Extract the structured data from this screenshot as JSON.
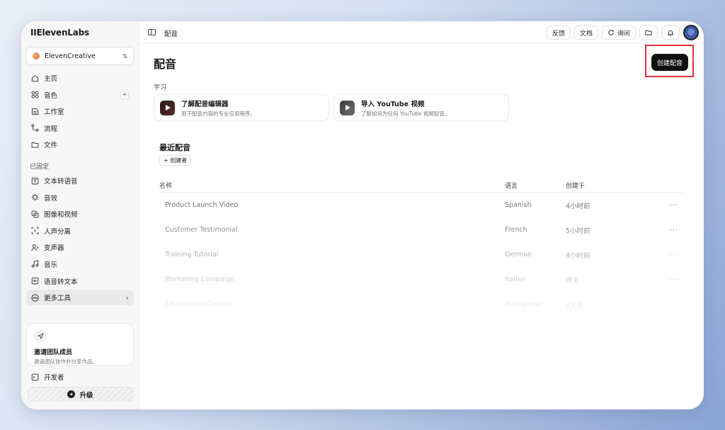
{
  "app": {
    "logo": "IIElevenLabs"
  },
  "workspace": {
    "name": "ElevenCreative"
  },
  "nav_main": [
    {
      "label": "主页",
      "icon": "home-icon"
    },
    {
      "label": "音色",
      "icon": "voices-icon",
      "plus": "+"
    },
    {
      "label": "工作室",
      "icon": "studio-icon"
    },
    {
      "label": "流程",
      "icon": "flow-icon"
    },
    {
      "label": "文件",
      "icon": "folder-icon"
    }
  ],
  "pinned_label": "已固定",
  "nav_pinned": [
    {
      "label": "文本转语音",
      "icon": "tts-icon"
    },
    {
      "label": "音效",
      "icon": "sound-effects-icon"
    },
    {
      "label": "图像和视频",
      "icon": "image-video-icon"
    },
    {
      "label": "人声分离",
      "icon": "voice-isolation-icon"
    },
    {
      "label": "变声器",
      "icon": "voice-changer-icon"
    },
    {
      "label": "音乐",
      "icon": "music-icon"
    },
    {
      "label": "语音转文本",
      "icon": "stt-icon"
    },
    {
      "label": "更多工具",
      "icon": "more-icon",
      "chevron": "›"
    }
  ],
  "invite": {
    "title": "邀请团队成员",
    "subtitle": "邀请团队协作并分享作品。"
  },
  "developer": {
    "label": "开发者"
  },
  "upgrade": {
    "label": "升级"
  },
  "topbar": {
    "breadcrumb": "配音",
    "feedback": "反馈",
    "docs": "文档",
    "ask": "询问"
  },
  "page": {
    "title": "配音",
    "create_button": "创建配音",
    "learn_label": "学习"
  },
  "learn_cards": [
    {
      "title": "了解配音编辑器",
      "subtitle": "用于配音内容的专业应用程序。"
    },
    {
      "title": "导入 YouTube 视频",
      "subtitle": "了解如何为任何 YouTube 视频配音。"
    }
  ],
  "recent": {
    "title": "最近配音",
    "creator_chip": "+ 创建者",
    "columns": {
      "name": "名称",
      "language": "语言",
      "created": "创建于"
    },
    "rows": [
      {
        "name": "Product Launch Video",
        "language": "Spanish",
        "created": "4小时前",
        "more": "···"
      },
      {
        "name": "Customer Testimonial",
        "language": "French",
        "created": "5小时前",
        "more": "···"
      },
      {
        "name": "Training Tutorial",
        "language": "German",
        "created": "8小时前",
        "more": "···"
      },
      {
        "name": "Marketing Campaign",
        "language": "Italian",
        "created": "昨天",
        "more": "···"
      },
      {
        "name": "Educational Content",
        "language": "Portuguese",
        "created": "2天前",
        "more": "···"
      }
    ]
  },
  "colors": {
    "accent": "#111111",
    "highlight": "#e0333c"
  }
}
